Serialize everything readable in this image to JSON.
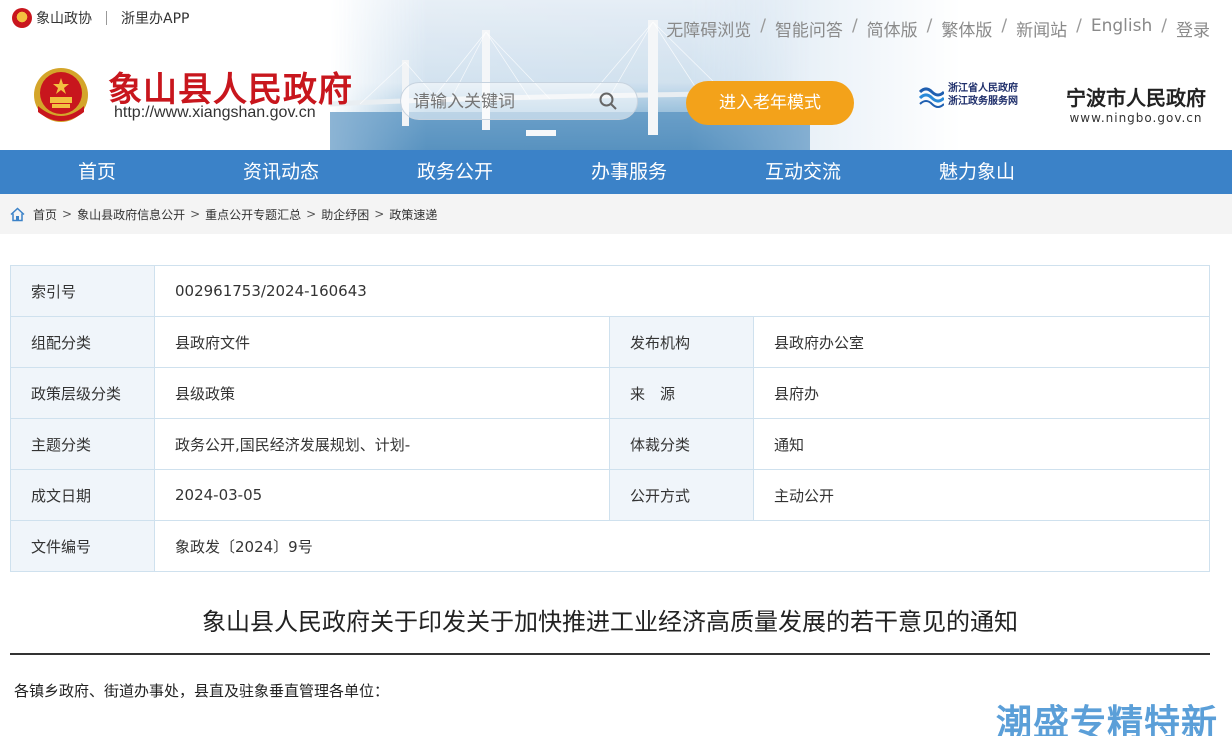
{
  "top_left": {
    "org_link": "象山政协",
    "app_link": "浙里办APP"
  },
  "top_right": {
    "links": [
      "无障碍浏览",
      "智能问答",
      "简体版",
      "繁体版",
      "新闻站",
      "English",
      "登录"
    ]
  },
  "header": {
    "title": "象山县人民政府",
    "url": "http://www.xiangshan.gov.cn"
  },
  "search": {
    "placeholder": "请输入关键词"
  },
  "elder_mode_label": "进入老年模式",
  "partner_logos": {
    "zhejiang_line1": "浙江省人民政府",
    "zhejiang_line2": "浙江政务服务网",
    "ningbo_title": "宁波市人民政府",
    "ningbo_url": "www.ningbo.gov.cn"
  },
  "nav": [
    "首页",
    "资讯动态",
    "政务公开",
    "办事服务",
    "互动交流",
    "魅力象山"
  ],
  "breadcrumb": [
    "首页",
    "象山县政府信息公开",
    "重点公开专题汇总",
    "助企纾困",
    "政策速递"
  ],
  "info_table": {
    "index_label": "索引号",
    "index_value": "002961753/2024-160643",
    "category_label": "组配分类",
    "category_value": "县政府文件",
    "publisher_label": "发布机构",
    "publisher_value": "县政府办公室",
    "level_label": "政策层级分类",
    "level_value": "县级政策",
    "source_label": "来　源",
    "source_value": "县府办",
    "topic_label": "主题分类",
    "topic_value": "政务公开,国民经济发展规划、计划-",
    "genre_label": "体裁分类",
    "genre_value": "通知",
    "date_label": "成文日期",
    "date_value": "2024-03-05",
    "disclosure_label": "公开方式",
    "disclosure_value": "主动公开",
    "docno_label": "文件编号",
    "docno_value": "象政发〔2024〕9号"
  },
  "article": {
    "title": "象山县人民政府关于印发关于加快推进工业经济高质量发展的若干意见的通知",
    "salutation": "各镇乡政府、街道办事处，县直及驻象垂直管理各单位："
  },
  "watermark": "潮盛专精特新",
  "colors": {
    "title_red": "#c8161d",
    "nav_blue": "#3b82c8",
    "elder_orange": "#f3a21a",
    "label_bg": "#f0f5fa"
  }
}
